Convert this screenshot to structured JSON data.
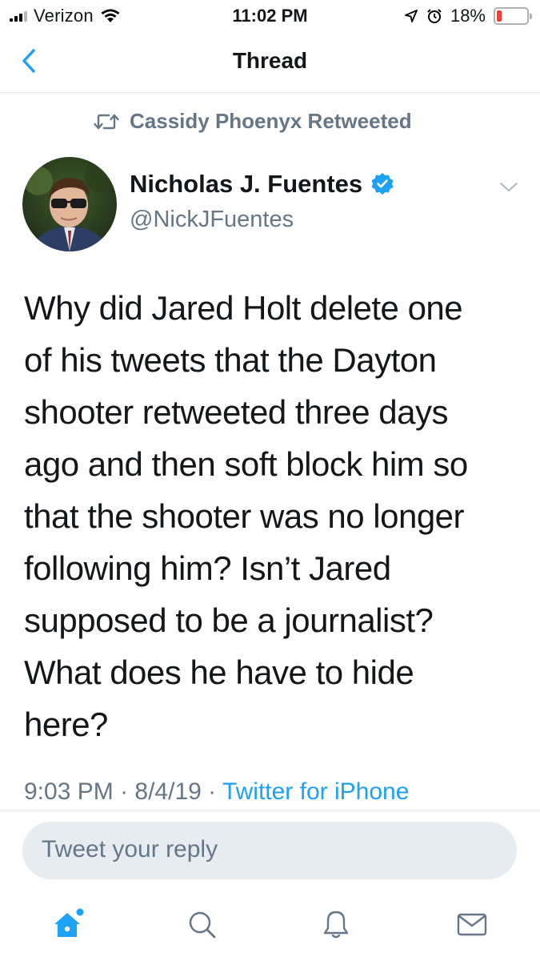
{
  "status_bar": {
    "carrier": "Verizon",
    "time": "11:02 PM",
    "battery_percent": "18%",
    "battery_level": 0.18,
    "battery_color": "#ff3b30"
  },
  "nav": {
    "title": "Thread",
    "back_icon": "chevron-left-icon",
    "accent_color": "#1da1f2"
  },
  "retweet_context": {
    "icon": "retweet-icon",
    "text": "Cassidy Phoenyx Retweeted"
  },
  "tweet": {
    "author_name": "Nicholas J. Fuentes",
    "verified": true,
    "handle": "@NickJFuentes",
    "lines": [
      "Why did Jared Holt delete one",
      "of his tweets that the Dayton",
      "shooter retweeted three days",
      "ago and then soft block him so",
      "that the shooter was no longer",
      "following him? Isn’t Jared",
      "supposed to be a journalist?",
      "What does he have to hide",
      "here?"
    ],
    "time": "9:03 PM",
    "separator": " · ",
    "date": "8/4/19",
    "source": "Twitter for iPhone"
  },
  "reply": {
    "placeholder": "Tweet your reply"
  },
  "tab_bar": {
    "tabs": [
      {
        "name": "home",
        "icon": "home-icon",
        "active": true
      },
      {
        "name": "search",
        "icon": "search-icon",
        "active": false
      },
      {
        "name": "notifications",
        "icon": "bell-icon",
        "active": false
      },
      {
        "name": "messages",
        "icon": "mail-icon",
        "active": false
      }
    ]
  }
}
